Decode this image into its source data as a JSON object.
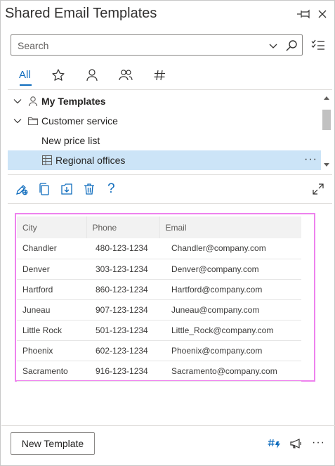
{
  "app": {
    "title": "Shared Email Templates"
  },
  "search": {
    "placeholder": "Search",
    "value": ""
  },
  "tabs": [
    {
      "label": "All",
      "active": true
    },
    {
      "icon": "star-icon"
    },
    {
      "icon": "person-icon"
    },
    {
      "icon": "people-icon"
    },
    {
      "icon": "hash-icon"
    }
  ],
  "tree": {
    "items": [
      {
        "label": "My Templates",
        "bold": true,
        "icon": "person-icon",
        "expanded": true
      },
      {
        "label": "Customer service",
        "icon": "folder-icon",
        "expanded": true
      },
      {
        "label": "New price list"
      },
      {
        "label": "Regional offices",
        "icon": "table-icon",
        "selected": true,
        "more": "···"
      }
    ]
  },
  "toolbar": {
    "icons": [
      "edit-icon",
      "copy-icon",
      "insert-icon",
      "delete-icon",
      "help-icon",
      "expand-icon"
    ],
    "help_label": "?"
  },
  "preview": {
    "headers": [
      "City",
      "Phone",
      "Email"
    ],
    "rows": [
      [
        "Chandler",
        "480-123-1234",
        "Chandler@company.com"
      ],
      [
        "Denver",
        "303-123-1234",
        "Denver@company.com"
      ],
      [
        "Hartford",
        "860-123-1234",
        "Hartford@company.com"
      ],
      [
        "Juneau",
        "907-123-1234",
        "Juneau@company.com"
      ],
      [
        "Little Rock",
        "501-123-1234",
        "Little_Rock@company.com"
      ],
      [
        "Phoenix",
        "602-123-1234",
        "Phoenix@company.com"
      ],
      [
        "Sacramento",
        "916-123-1234",
        "Sacramento@company.com"
      ]
    ]
  },
  "footer": {
    "new_template_label": "New Template",
    "more": "···",
    "icons": [
      "macro-icon",
      "announce-icon"
    ]
  },
  "colors": {
    "accent": "#0f6cbd",
    "selection": "#cce4f7",
    "highlight_border": "#ee82ee"
  }
}
